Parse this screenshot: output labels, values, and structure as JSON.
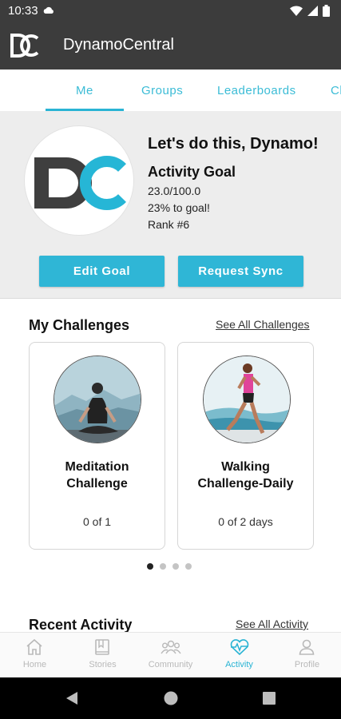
{
  "status_bar": {
    "time": "10:33"
  },
  "app_bar": {
    "logo_text": "DC",
    "title": "DynamoCentral"
  },
  "tabs": [
    {
      "label": "Me",
      "active": true
    },
    {
      "label": "Groups"
    },
    {
      "label": "Leaderboards"
    },
    {
      "label": "Cl"
    }
  ],
  "profile": {
    "avatar_text": "DC",
    "greeting": "Let's do this, Dynamo!",
    "goal_title": "Activity Goal",
    "goal_value": "23.0/100.0",
    "goal_percent": "23% to goal!",
    "rank": "Rank #6",
    "edit_goal_label": "Edit Goal",
    "request_sync_label": "Request Sync"
  },
  "challenges": {
    "title": "My Challenges",
    "see_all_label": "See All Challenges",
    "items": [
      {
        "name_line1": "Meditation",
        "name_line2": "Challenge",
        "progress": "0 of 1"
      },
      {
        "name_line1": "Walking",
        "name_line2": "Challenge-Daily",
        "progress": "0 of 2 days"
      }
    ],
    "pages": 4,
    "current_page": 1
  },
  "recent_activity": {
    "title": "Recent Activity",
    "see_all_label": "See All Activity"
  },
  "bottom_nav": [
    {
      "label": "Home",
      "icon": "home-icon"
    },
    {
      "label": "Stories",
      "icon": "book-icon"
    },
    {
      "label": "Community",
      "icon": "community-icon"
    },
    {
      "label": "Activity",
      "icon": "heartbeat-icon",
      "active": true
    },
    {
      "label": "Profile",
      "icon": "person-icon"
    }
  ],
  "colors": {
    "accent": "#2fb6d6",
    "header": "#3c3c3c",
    "logo_dark": "#3f3f3f",
    "logo_cyan": "#26b6d6"
  }
}
